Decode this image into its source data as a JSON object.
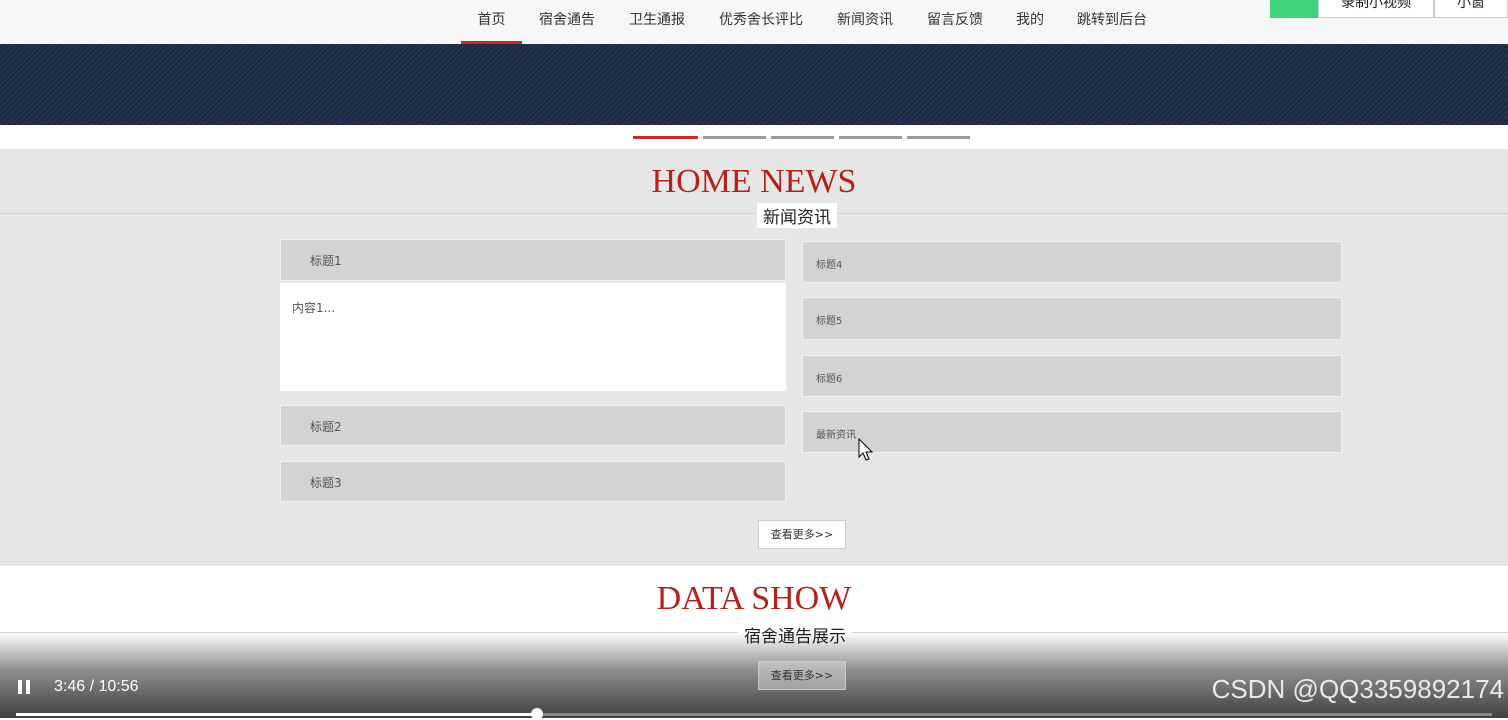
{
  "nav": {
    "items": [
      {
        "label": "首页",
        "active": true
      },
      {
        "label": "宿舍通告"
      },
      {
        "label": "卫生通报"
      },
      {
        "label": "优秀舍长评比"
      },
      {
        "label": "新闻资讯"
      },
      {
        "label": "留言反馈"
      },
      {
        "label": "我的"
      },
      {
        "label": "跳转到后台"
      }
    ]
  },
  "topright": {
    "record_label": "录制小视频",
    "small_label": "小窗"
  },
  "carousel": {
    "dot_count": 5,
    "active_index": 0
  },
  "news": {
    "title": "HOME NEWS",
    "subtitle": "新闻资讯",
    "left_items": [
      "标题1",
      "标题2",
      "标题3"
    ],
    "content_text": "内容1...",
    "right_items": [
      "标题4",
      "标题5",
      "标题6",
      "最新资讯"
    ],
    "more_label": "查看更多>>"
  },
  "data_show": {
    "title": "DATA SHOW",
    "subtitle": "宿舍通告展示",
    "more_label": "查看更多>>"
  },
  "video": {
    "time": "3:46 / 10:56",
    "progress": 0.353,
    "watermark": "CSDN @QQ3359892174"
  },
  "colors": {
    "accent": "#c0302a",
    "banner": "#1d2b46"
  }
}
